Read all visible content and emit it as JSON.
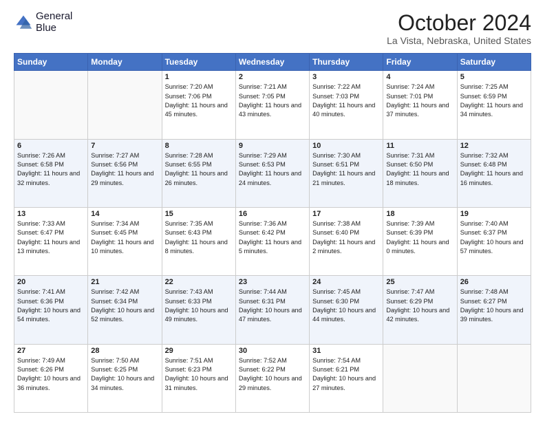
{
  "header": {
    "logo_line1": "General",
    "logo_line2": "Blue",
    "title": "October 2024",
    "subtitle": "La Vista, Nebraska, United States"
  },
  "days_of_week": [
    "Sunday",
    "Monday",
    "Tuesday",
    "Wednesday",
    "Thursday",
    "Friday",
    "Saturday"
  ],
  "weeks": [
    [
      {
        "day": "",
        "info": ""
      },
      {
        "day": "",
        "info": ""
      },
      {
        "day": "1",
        "info": "Sunrise: 7:20 AM\nSunset: 7:06 PM\nDaylight: 11 hours and 45 minutes."
      },
      {
        "day": "2",
        "info": "Sunrise: 7:21 AM\nSunset: 7:05 PM\nDaylight: 11 hours and 43 minutes."
      },
      {
        "day": "3",
        "info": "Sunrise: 7:22 AM\nSunset: 7:03 PM\nDaylight: 11 hours and 40 minutes."
      },
      {
        "day": "4",
        "info": "Sunrise: 7:24 AM\nSunset: 7:01 PM\nDaylight: 11 hours and 37 minutes."
      },
      {
        "day": "5",
        "info": "Sunrise: 7:25 AM\nSunset: 6:59 PM\nDaylight: 11 hours and 34 minutes."
      }
    ],
    [
      {
        "day": "6",
        "info": "Sunrise: 7:26 AM\nSunset: 6:58 PM\nDaylight: 11 hours and 32 minutes."
      },
      {
        "day": "7",
        "info": "Sunrise: 7:27 AM\nSunset: 6:56 PM\nDaylight: 11 hours and 29 minutes."
      },
      {
        "day": "8",
        "info": "Sunrise: 7:28 AM\nSunset: 6:55 PM\nDaylight: 11 hours and 26 minutes."
      },
      {
        "day": "9",
        "info": "Sunrise: 7:29 AM\nSunset: 6:53 PM\nDaylight: 11 hours and 24 minutes."
      },
      {
        "day": "10",
        "info": "Sunrise: 7:30 AM\nSunset: 6:51 PM\nDaylight: 11 hours and 21 minutes."
      },
      {
        "day": "11",
        "info": "Sunrise: 7:31 AM\nSunset: 6:50 PM\nDaylight: 11 hours and 18 minutes."
      },
      {
        "day": "12",
        "info": "Sunrise: 7:32 AM\nSunset: 6:48 PM\nDaylight: 11 hours and 16 minutes."
      }
    ],
    [
      {
        "day": "13",
        "info": "Sunrise: 7:33 AM\nSunset: 6:47 PM\nDaylight: 11 hours and 13 minutes."
      },
      {
        "day": "14",
        "info": "Sunrise: 7:34 AM\nSunset: 6:45 PM\nDaylight: 11 hours and 10 minutes."
      },
      {
        "day": "15",
        "info": "Sunrise: 7:35 AM\nSunset: 6:43 PM\nDaylight: 11 hours and 8 minutes."
      },
      {
        "day": "16",
        "info": "Sunrise: 7:36 AM\nSunset: 6:42 PM\nDaylight: 11 hours and 5 minutes."
      },
      {
        "day": "17",
        "info": "Sunrise: 7:38 AM\nSunset: 6:40 PM\nDaylight: 11 hours and 2 minutes."
      },
      {
        "day": "18",
        "info": "Sunrise: 7:39 AM\nSunset: 6:39 PM\nDaylight: 11 hours and 0 minutes."
      },
      {
        "day": "19",
        "info": "Sunrise: 7:40 AM\nSunset: 6:37 PM\nDaylight: 10 hours and 57 minutes."
      }
    ],
    [
      {
        "day": "20",
        "info": "Sunrise: 7:41 AM\nSunset: 6:36 PM\nDaylight: 10 hours and 54 minutes."
      },
      {
        "day": "21",
        "info": "Sunrise: 7:42 AM\nSunset: 6:34 PM\nDaylight: 10 hours and 52 minutes."
      },
      {
        "day": "22",
        "info": "Sunrise: 7:43 AM\nSunset: 6:33 PM\nDaylight: 10 hours and 49 minutes."
      },
      {
        "day": "23",
        "info": "Sunrise: 7:44 AM\nSunset: 6:31 PM\nDaylight: 10 hours and 47 minutes."
      },
      {
        "day": "24",
        "info": "Sunrise: 7:45 AM\nSunset: 6:30 PM\nDaylight: 10 hours and 44 minutes."
      },
      {
        "day": "25",
        "info": "Sunrise: 7:47 AM\nSunset: 6:29 PM\nDaylight: 10 hours and 42 minutes."
      },
      {
        "day": "26",
        "info": "Sunrise: 7:48 AM\nSunset: 6:27 PM\nDaylight: 10 hours and 39 minutes."
      }
    ],
    [
      {
        "day": "27",
        "info": "Sunrise: 7:49 AM\nSunset: 6:26 PM\nDaylight: 10 hours and 36 minutes."
      },
      {
        "day": "28",
        "info": "Sunrise: 7:50 AM\nSunset: 6:25 PM\nDaylight: 10 hours and 34 minutes."
      },
      {
        "day": "29",
        "info": "Sunrise: 7:51 AM\nSunset: 6:23 PM\nDaylight: 10 hours and 31 minutes."
      },
      {
        "day": "30",
        "info": "Sunrise: 7:52 AM\nSunset: 6:22 PM\nDaylight: 10 hours and 29 minutes."
      },
      {
        "day": "31",
        "info": "Sunrise: 7:54 AM\nSunset: 6:21 PM\nDaylight: 10 hours and 27 minutes."
      },
      {
        "day": "",
        "info": ""
      },
      {
        "day": "",
        "info": ""
      }
    ]
  ]
}
